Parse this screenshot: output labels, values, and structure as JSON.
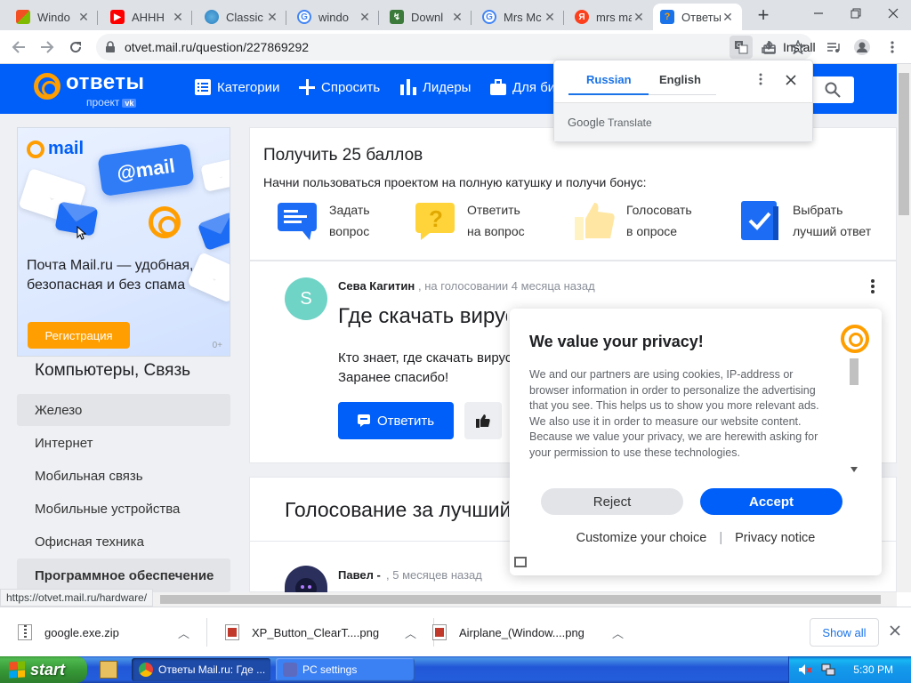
{
  "browser": {
    "tabs": [
      {
        "title": "Windo",
        "icon": "windows-xp-icon"
      },
      {
        "title": "АННН",
        "icon": "youtube-icon"
      },
      {
        "title": "Classic",
        "icon": "globe-icon"
      },
      {
        "title": "windo",
        "icon": "google-icon"
      },
      {
        "title": "Downl",
        "icon": "download-site-icon"
      },
      {
        "title": "Mrs Mc",
        "icon": "google-icon"
      },
      {
        "title": "mrs ma",
        "icon": "yandex-icon"
      },
      {
        "title": "Ответы",
        "icon": "answers-icon",
        "active": true
      }
    ],
    "url": "otvet.mail.ru/question/227869292",
    "install_label": "Install",
    "status_url": "https://otvet.mail.ru/hardware/"
  },
  "translate_popup": {
    "lang_source": "Russian",
    "lang_target": "English",
    "brand": "Google",
    "brand_suffix": "Translate"
  },
  "site": {
    "logo_word": "ответы",
    "logo_sub": "проект",
    "logo_badge": "vk",
    "nav": {
      "categories": "Категории",
      "ask": "Спросить",
      "leaders": "Лидеры",
      "business": "Для би"
    }
  },
  "ad": {
    "brand": "mail",
    "badge": "@mail",
    "text": "Почта Mail.ru — удобная, безопасная и без спама",
    "button": "Регистрация",
    "marker": "0+"
  },
  "sidebar": {
    "title": "Компьютеры, Связь",
    "items": [
      {
        "label": "Железо"
      },
      {
        "label": "Интернет"
      },
      {
        "label": "Мобильная связь"
      },
      {
        "label": "Мобильные устройства"
      },
      {
        "label": "Офисная техника"
      },
      {
        "label": "Программное обеспечение"
      }
    ]
  },
  "bonus": {
    "title": "Получить 25 баллов",
    "subtitle": "Начни пользоваться проектом на полную катушку и получи бонус:",
    "items": [
      {
        "line1": "Задать",
        "line2": "вопрос"
      },
      {
        "line1": "Ответить",
        "line2": "на вопрос"
      },
      {
        "line1": "Голосовать",
        "line2": "в опросе"
      },
      {
        "line1": "Выбрать",
        "line2": "лучший ответ"
      }
    ]
  },
  "question": {
    "avatar_letter": "S",
    "author": "Сева Кагитин",
    "meta": ", на голосовании 4 месяца назад",
    "title": "Где скачать вирус",
    "text": "Кто знает, где скачать вирус Заранее спасибо!",
    "answer_button": "Ответить"
  },
  "voting": {
    "title": "Голосование за лучший",
    "author": "Павел -",
    "meta": ", 5 месяцев назад"
  },
  "privacy": {
    "title": "We value your privacy!",
    "body": "We and our partners are using cookies, IP-address or browser information in order to personalize the advertising that you see. This helps us to show you more relevant ads. We also use it in order to measure our website content. Because we value your privacy, we are herewith asking for your permission to use these technologies.",
    "reject": "Reject",
    "accept": "Accept",
    "customize": "Customize your choice",
    "separator": "|",
    "notice": "Privacy notice"
  },
  "downloads": {
    "items": [
      {
        "name": "google.exe.zip"
      },
      {
        "name": "XP_Button_ClearT....png"
      },
      {
        "name": "Airplane_(Window....png"
      }
    ],
    "show_all": "Show all"
  },
  "taskbar": {
    "start": "start",
    "tasks": [
      {
        "title": "Ответы Mail.ru: Где ..."
      },
      {
        "title": "PC settings"
      }
    ],
    "clock": "5:30 PM"
  },
  "colors": {
    "site_blue": "#005ff9",
    "accent_orange": "#ff9e00",
    "chrome_blue": "#1a73e8"
  }
}
